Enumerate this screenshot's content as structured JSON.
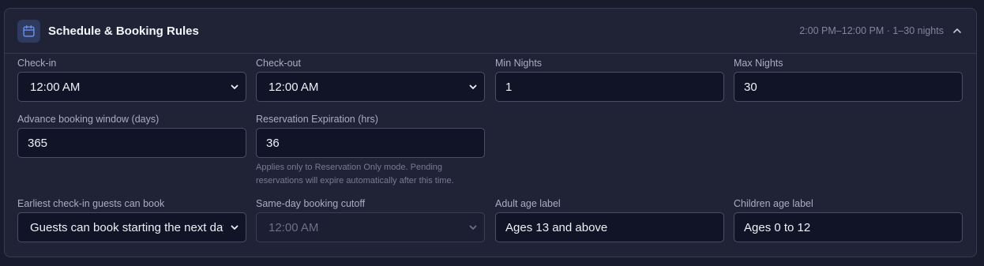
{
  "section": {
    "title": "Schedule & Booking Rules",
    "summary": "2:00 PM–12:00 PM · 1–30 nights"
  },
  "fields": {
    "checkin": {
      "label": "Check-in",
      "value": "12:00 AM"
    },
    "checkout": {
      "label": "Check-out",
      "value": "12:00 AM"
    },
    "min_nights": {
      "label": "Min Nights",
      "value": "1"
    },
    "max_nights": {
      "label": "Max Nights",
      "value": "30"
    },
    "advance_window": {
      "label": "Advance booking window (days)",
      "value": "365"
    },
    "reservation_expiration": {
      "label": "Reservation Expiration (hrs)",
      "value": "36",
      "help_line1": "Applies only to Reservation Only mode. Pending",
      "help_line2": "reservations will expire automatically after this time."
    },
    "earliest_checkin": {
      "label": "Earliest check-in guests can book",
      "value": "Guests can book starting the next day"
    },
    "same_day_cutoff": {
      "label": "Same-day booking cutoff",
      "value": "12:00 AM"
    },
    "adult_age_label": {
      "label": "Adult age label",
      "value": "Ages 13 and above"
    },
    "children_age_label": {
      "label": "Children age label",
      "value": "Ages 0 to 12"
    }
  },
  "icons": {
    "header": "calendar-icon",
    "collapse": "chevron-up-icon",
    "select": "chevron-down-icon"
  },
  "colors": {
    "background": "#181b2c",
    "panel": "#1f2335",
    "input": "#111426",
    "accent": "#6c8fe8"
  }
}
